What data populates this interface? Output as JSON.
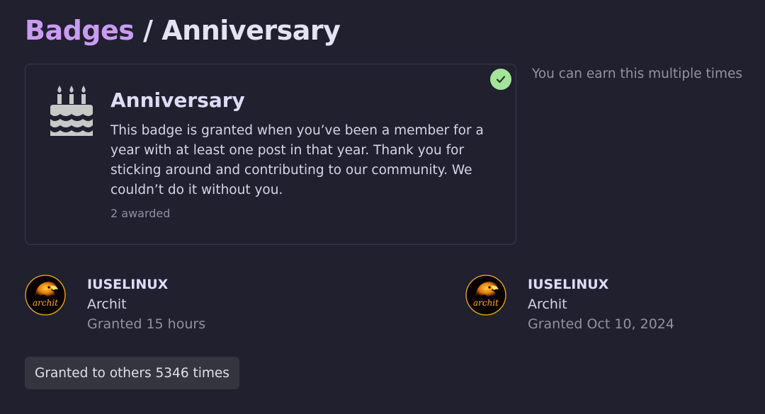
{
  "breadcrumb": {
    "parent": "Badges",
    "separator": "/",
    "current": "Anniversary"
  },
  "badge": {
    "icon": "birthday-cake-icon",
    "status_icon": "check-icon",
    "title": "Anniversary",
    "description": "This badge is granted when you’ve been a member for a year with at least one post in that year. Thank you for sticking around and contributing to our community. We couldn’t do it without you.",
    "awarded": "2 awarded"
  },
  "multiple_note": "You can earn this multiple times",
  "grants": [
    {
      "avatar_icon": "eagle-avatar-icon",
      "avatar_text": "archit",
      "username": "IUSELINUX",
      "name": "Archit",
      "granted": "Granted 15 hours"
    },
    {
      "avatar_icon": "eagle-avatar-icon",
      "avatar_text": "archit",
      "username": "IUSELINUX",
      "name": "Archit",
      "granted": "Granted Oct 10, 2024"
    }
  ],
  "others_button": "Granted to others 5346 times",
  "colors": {
    "background": "#20202f",
    "link": "#c99cf2",
    "check_badge": "#a4e59b",
    "muted_text": "#93939f"
  }
}
